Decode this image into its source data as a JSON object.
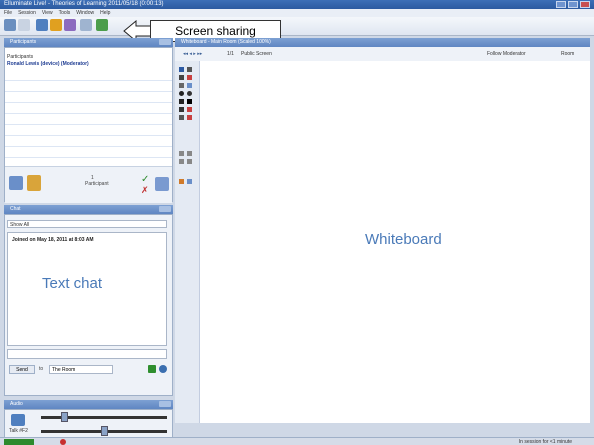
{
  "titlebar": {
    "title": "Elluminate Live! - Theories of Learning 2011/05/18 (0:00:13)"
  },
  "menu": [
    "File",
    "Session",
    "View",
    "Tools",
    "Window",
    "Help"
  ],
  "callout": {
    "label": "Screen sharing"
  },
  "participants": {
    "panel_title": "Participants",
    "header": "Participants",
    "user": "Ronald Lewis (device) (Moderator)",
    "footer_count": "1",
    "footer_label": "Participant"
  },
  "chat": {
    "panel_title": "Chat",
    "filter_label": "Show",
    "filter_value": "All",
    "joined_message": "Joined on May 18, 2011 at 8:03 AM",
    "overlay_label": "Text chat",
    "send_label": "Send",
    "to_label": "to",
    "room_value": "The Room"
  },
  "audio": {
    "panel_title": "Audio",
    "talk_label": "Talk #F2"
  },
  "whiteboard": {
    "panel_title": "Whiteboard - Main Room (Scaled 100%)",
    "page": "1/1",
    "screen": "Public Screen",
    "follow_label": "Follow Moderator",
    "room_label": "Room",
    "overlay_label": "Whiteboard"
  },
  "status": {
    "right_text": "In session for <1 minute"
  },
  "colors": {
    "accent": "#4a7ab8",
    "titlebar": "#2c5aa0",
    "panel_header": "#6a8fc9"
  }
}
